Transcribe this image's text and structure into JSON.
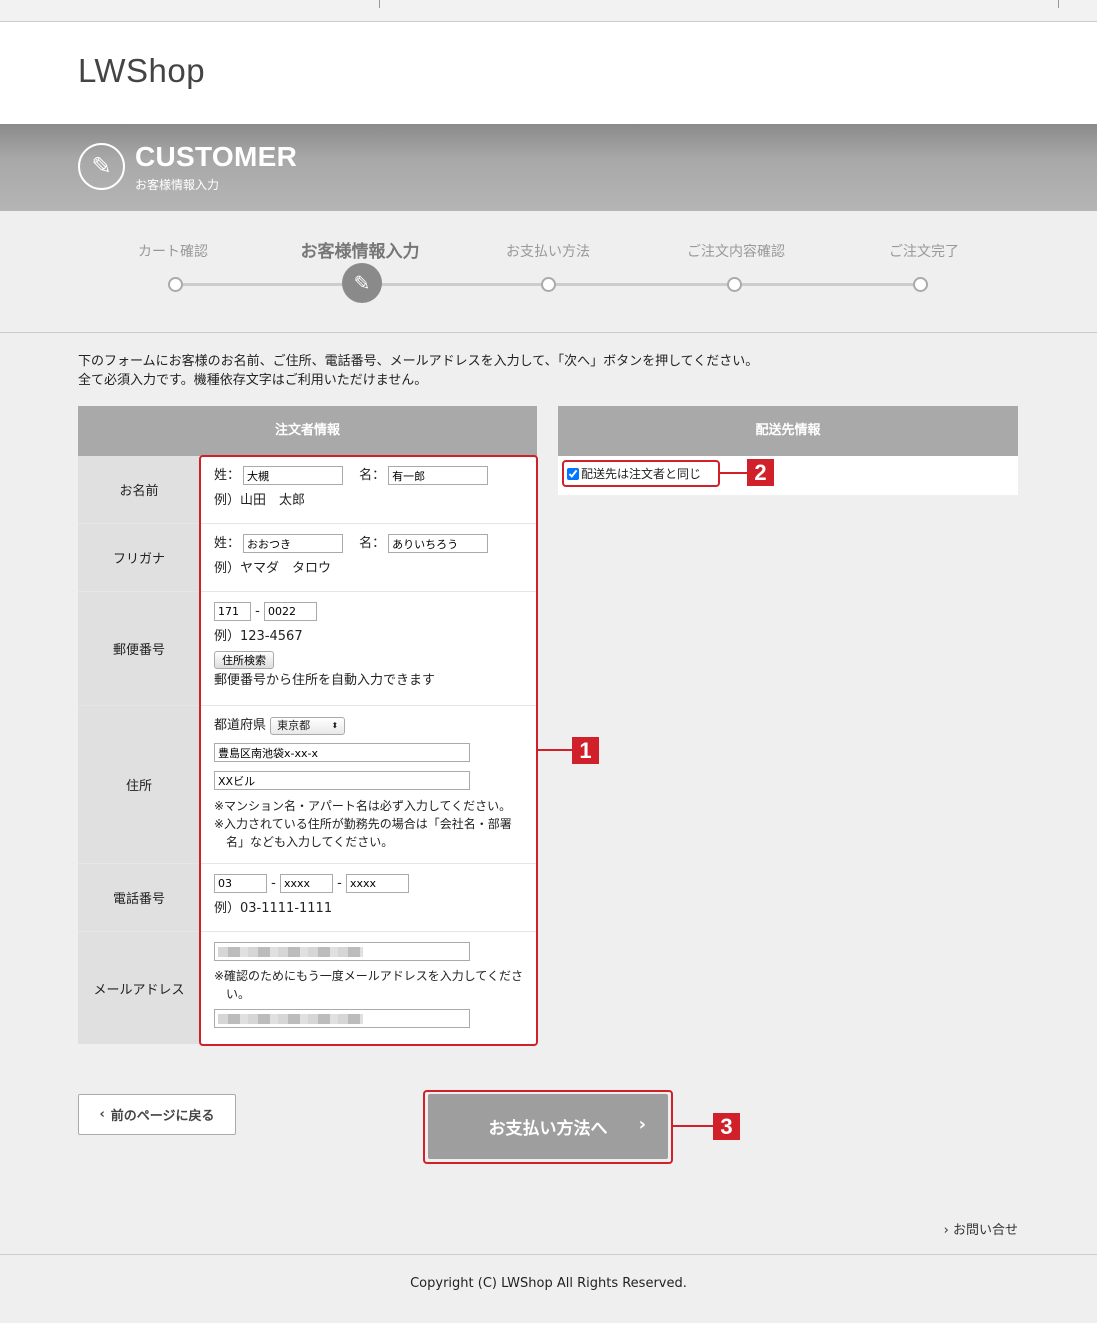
{
  "site": {
    "logo": "LWShop"
  },
  "banner": {
    "title": "CUSTOMER",
    "subtitle": "お客様情報入力",
    "icon": "pen-icon"
  },
  "steps": [
    {
      "label": "カート確認",
      "active": false
    },
    {
      "label": "お客様情報入力",
      "active": true
    },
    {
      "label": "お支払い方法",
      "active": false
    },
    {
      "label": "ご注文内容確認",
      "active": false
    },
    {
      "label": "ご注文完了",
      "active": false
    }
  ],
  "intro": {
    "line1": "下のフォームにお客様のお名前、ご住所、電話番号、メールアドレスを入力して、「次へ」ボタンを押してください。",
    "line2": "全て必須入力です。機種依存文字はご利用いただけません。"
  },
  "orderer": {
    "heading": "注文者情報",
    "name": {
      "label": "お名前",
      "sei_label": "姓：",
      "sei": "大槻",
      "mei_label": "名：",
      "mei": "有一郎",
      "example": "例）山田　太郎"
    },
    "kana": {
      "label": "フリガナ",
      "sei_label": "姓：",
      "sei": "おおつき",
      "mei_label": "名：",
      "mei": "ありいちろう",
      "example": "例）ヤマダ　タロウ"
    },
    "postal": {
      "label": "郵便番号",
      "part1": "171",
      "sep": "-",
      "part2": "0022",
      "example": "例）123-4567",
      "search_button": "住所検索",
      "note": "郵便番号から住所を自動入力できます"
    },
    "address": {
      "label": "住所",
      "pref_label": "都道府県",
      "pref": "東京都",
      "line1": "豊島区南池袋x-xx-x",
      "line2": "XXビル",
      "note1": "※マンション名・アパート名は必ず入力してください。",
      "note2": "※入力されている住所が勤務先の場合は「会社名・部署",
      "note3": "名」なども入力してください。"
    },
    "phone": {
      "label": "電話番号",
      "part1": "03",
      "sep1": "-",
      "part2": "xxxx",
      "sep2": "-",
      "part3": "xxxx",
      "example": "例）03-1111-1111"
    },
    "email": {
      "label": "メールアドレス",
      "note1": "※確認のためにもう一度メールアドレスを入力してくださ",
      "note2": "い。"
    }
  },
  "shipping": {
    "heading": "配送先情報",
    "same_label": "配送先は注文者と同じ",
    "same_checked": true
  },
  "callouts": {
    "one": "1",
    "two": "2",
    "three": "3"
  },
  "buttons": {
    "back": "前のページに戻る",
    "next": "お支払い方法へ"
  },
  "contact": "お問い合せ",
  "footer": "Copyright (C) LWShop All Rights Reserved."
}
